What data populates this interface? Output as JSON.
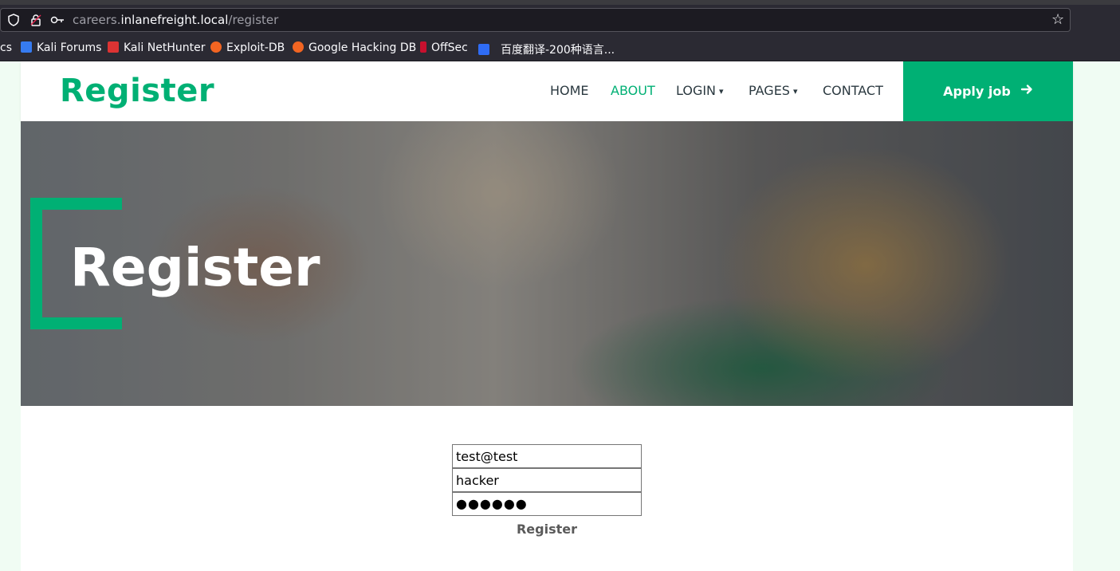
{
  "browser": {
    "url_prefix": "careers.",
    "url_domain": "inlanefreight.local",
    "url_path": "/register",
    "bookmarks": [
      "cs",
      "Kali Forums",
      "Kali NetHunter",
      "Exploit-DB",
      "Google Hacking DB",
      "OffSec",
      "百度翻译-200种语言..."
    ]
  },
  "nav": {
    "brand": "Register",
    "items": [
      "HOME",
      "ABOUT",
      "LOGIN",
      "PAGES",
      "CONTACT"
    ],
    "apply_label": "Apply job"
  },
  "hero": {
    "title": "Register"
  },
  "form": {
    "email_value": "test@test",
    "username_value": "hacker",
    "password_value": "●●●●●●",
    "submit_label": "Register"
  },
  "colors": {
    "accent": "#00b074",
    "browser_bg": "#2b2a33"
  }
}
